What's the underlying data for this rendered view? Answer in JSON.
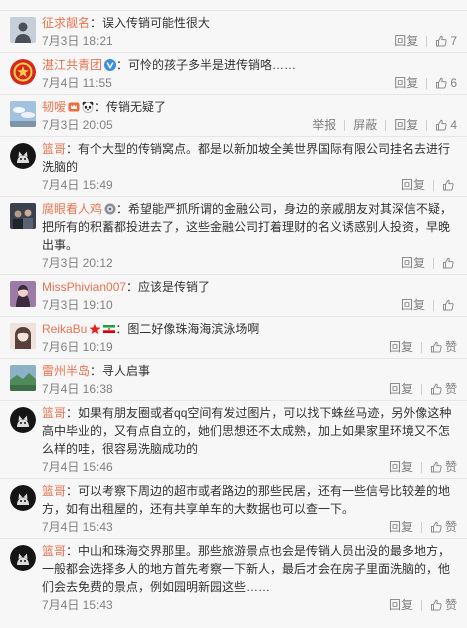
{
  "theme": {
    "name_color": "#eb7350",
    "meta_color": "#808080",
    "background": "#f7f7f7"
  },
  "comments": [
    {
      "user": "征求靓名",
      "badges": [],
      "text": "：误入传销可能性很大",
      "time": "7月3日 18:21",
      "actions": [
        "回复"
      ],
      "like": "7",
      "avatar": {
        "icon": "person-avatar",
        "color": "#c5cfd9"
      }
    },
    {
      "user": "湛江共青团",
      "badges": [
        "verified-icon"
      ],
      "text": "：可怜的孩子多半是进传销咯……",
      "time": "7月4日 11:55",
      "actions": [
        "回复"
      ],
      "like": "6",
      "avatar": {
        "icon": "logo-avatar",
        "color": "#d7261e"
      }
    },
    {
      "user": "韧嗳",
      "badges": [
        "member-icon",
        "panda-icon"
      ],
      "text": "：传销无疑了",
      "time": "7月3日 20:05",
      "actions": [
        "举报",
        "屏蔽",
        "回复"
      ],
      "like": "4",
      "avatar": {
        "icon": "sky-avatar",
        "color": "#a3c2df"
      }
    },
    {
      "user": "篮哥",
      "badges": [],
      "text": "：有个大型的传销窝点。都是以新加坡全美世界国际有限公司挂名去进行洗脑的",
      "time": "7月4日 15:49",
      "actions": [
        "回复"
      ],
      "avatar": {
        "icon": "cat-avatar",
        "color": "#151515"
      }
    },
    {
      "user": "腐眼看人鸡",
      "badges": [
        "badge-icon"
      ],
      "text": "：希望能严抓所谓的金融公司，身边的亲戚朋友对其深信不疑，把所有的积蓄都投进去了，这些金融公司打着理财的名义诱惑别人投资，早晚出事。",
      "time": "7月3日 20:12",
      "actions": [
        "回复"
      ],
      "avatar": {
        "icon": "group-avatar",
        "color": "#3a404c"
      }
    },
    {
      "user": "MissPhivian007",
      "badges": [],
      "text": "：应该是传销了",
      "time": "7月3日 19:10",
      "actions": [
        "回复"
      ],
      "avatar": {
        "icon": "portrait-avatar",
        "color": "#9b7ca6"
      }
    },
    {
      "user": "ReikaBu",
      "badges": [
        "star-icon",
        "flag-icon"
      ],
      "text": "：图二好像珠海海滨泳场啊",
      "time": "7月6日 10:19",
      "actions": [
        "回复"
      ],
      "like": "赞",
      "avatar": {
        "icon": "girl-avatar",
        "color": "#eee2dd"
      }
    },
    {
      "user": "雷州半岛",
      "badges": [],
      "text": "：寻人启事",
      "time": "7月4日 16:38",
      "actions": [
        "回复"
      ],
      "like": "赞",
      "avatar": {
        "icon": "landscape-avatar",
        "color": "#8db2c8"
      }
    },
    {
      "user": "篮哥",
      "badges": [],
      "text": "：如果有朋友圈或者qq空间有发过图片，可以找下蛛丝马迹，另外像这种高中毕业的，又有点自立的，她们思想还不太成熟，加上如果家里环境又不怎么样的哇，很容易洗脑成功的",
      "time": "7月4日 15:46",
      "actions": [
        "回复"
      ],
      "like": "赞",
      "avatar": {
        "icon": "cat-avatar",
        "color": "#151515"
      }
    },
    {
      "user": "篮哥",
      "badges": [],
      "text": "：可以考察下周边的超市或者路边的那些民居，还有一些信号比较差的地方，如有出租屋的，还有共享单车的大数据也可以查一下。",
      "time": "7月4日 15:43",
      "actions": [
        "回复"
      ],
      "like": "赞",
      "avatar": {
        "icon": "cat-avatar",
        "color": "#151515"
      }
    },
    {
      "user": "篮哥",
      "badges": [],
      "text": "：中山和珠海交界那里。那些旅游景点也会是传销人员出没的最多地方，一般都会选择多人的地方首先考察一下新人，最后才会在房子里面洗脑的，他们会去免费的景点，例如园明新园这些……",
      "time": "7月4日 15:43",
      "actions": [
        "回复"
      ],
      "like": "赞",
      "avatar": {
        "icon": "cat-avatar",
        "color": "#151515"
      }
    }
  ]
}
